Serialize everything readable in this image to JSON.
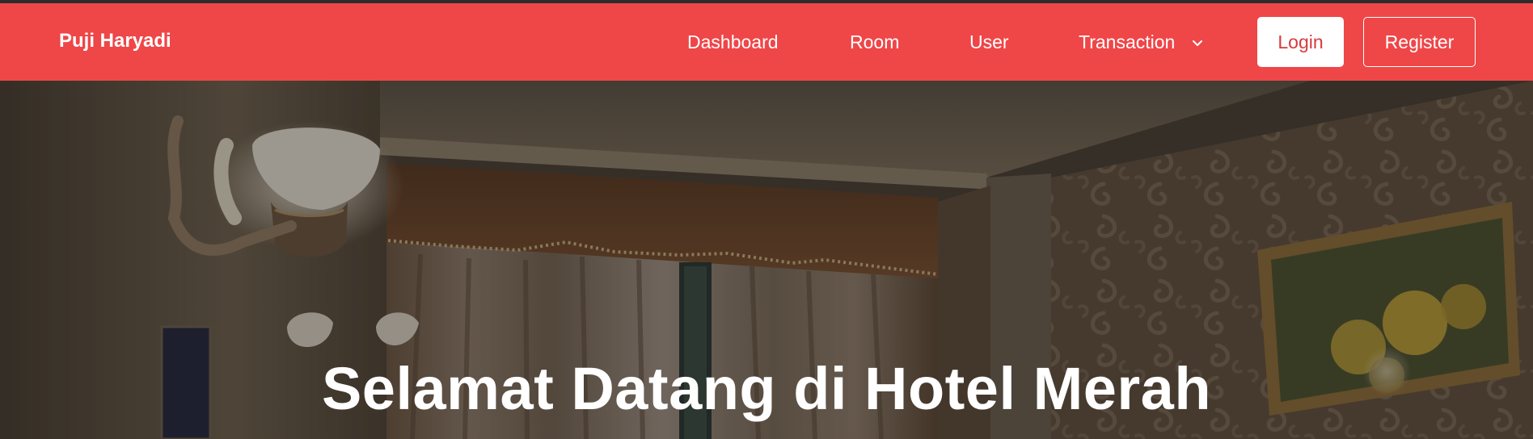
{
  "navbar": {
    "brand": "Puji Haryadi",
    "links": [
      {
        "label": "Dashboard"
      },
      {
        "label": "Room"
      },
      {
        "label": "User"
      },
      {
        "label": "Transaction"
      }
    ],
    "login_label": "Login",
    "register_label": "Register",
    "background_color": "#ef4648"
  },
  "hero": {
    "title": "Selamat Datang di Hotel Merah"
  }
}
